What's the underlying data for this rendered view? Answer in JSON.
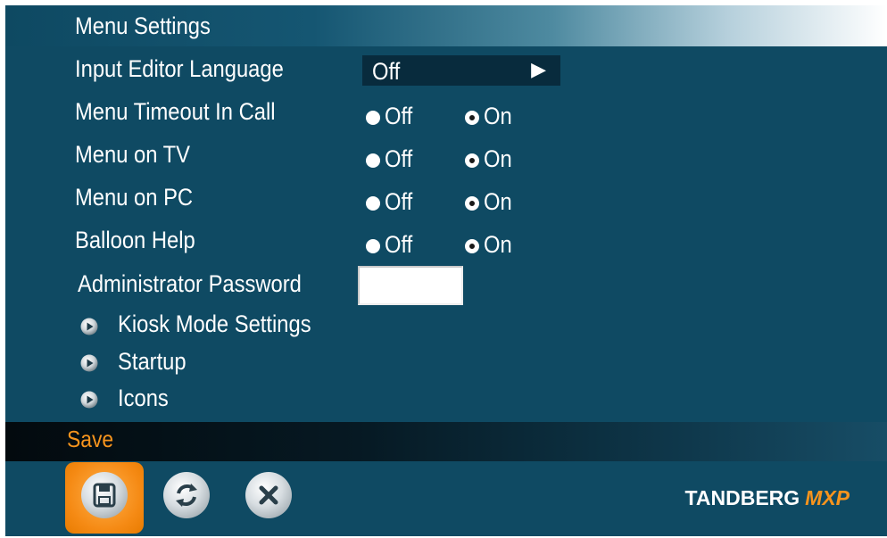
{
  "window": {
    "title": "Menu Settings"
  },
  "settings": {
    "input_editor_language": {
      "label": "Input Editor Language",
      "value": "Off",
      "arrow": "▶"
    },
    "menu_timeout_in_call": {
      "label": "Menu Timeout In Call",
      "off_label": "Off",
      "on_label": "On",
      "selected": "On"
    },
    "menu_on_tv": {
      "label": "Menu on TV",
      "off_label": "Off",
      "on_label": "On",
      "selected": "On"
    },
    "menu_on_pc": {
      "label": "Menu on PC",
      "off_label": "Off",
      "on_label": "On",
      "selected": "On"
    },
    "balloon_help": {
      "label": "Balloon Help",
      "off_label": "Off",
      "on_label": "On",
      "selected": "On"
    },
    "administrator_password": {
      "label": "Administrator Password",
      "value": ""
    }
  },
  "submenus": [
    {
      "label": "Kiosk Mode Settings",
      "icon": "play-circle-icon"
    },
    {
      "label": "Startup",
      "icon": "play-circle-icon"
    },
    {
      "label": "Icons",
      "icon": "play-circle-icon"
    }
  ],
  "footer": {
    "action_label": "Save",
    "buttons": [
      {
        "name": "save",
        "icon": "floppy-disk-icon",
        "selected": true
      },
      {
        "name": "refresh",
        "icon": "refresh-icon",
        "selected": false
      },
      {
        "name": "cancel",
        "icon": "close-icon",
        "selected": false
      }
    ],
    "brand": "TANDBERG",
    "brand_suffix": "MXP"
  },
  "colors": {
    "background": "#0f4a63",
    "accent_orange": "#f7941d",
    "text": "#ffffff",
    "select_bg": "#082b3d"
  }
}
